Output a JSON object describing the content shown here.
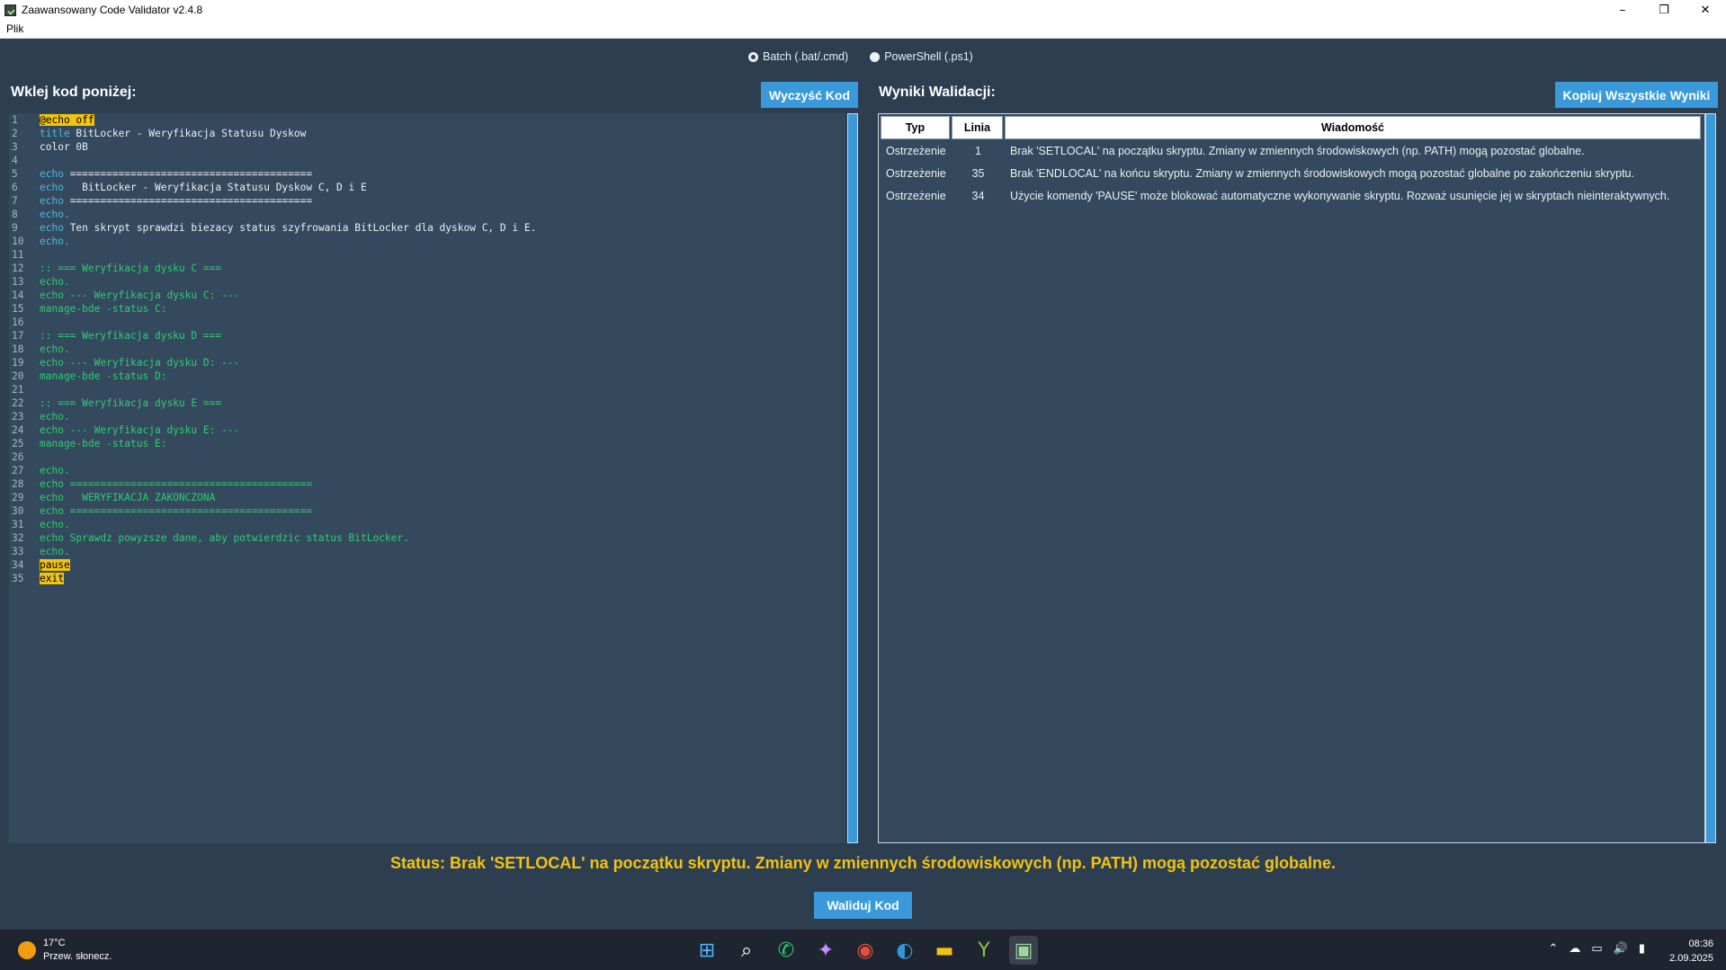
{
  "window": {
    "title": "Zaawansowany Code Validator v2.4.8",
    "minimize": "–",
    "restore": "❐",
    "close": "✕"
  },
  "menu": {
    "items": [
      "Plik"
    ]
  },
  "script_type": {
    "options": [
      "Batch (.bat/.cmd)",
      "PowerShell (.ps1)"
    ],
    "selected": "Batch (.bat/.cmd)"
  },
  "editor": {
    "heading": "Wklej kod poniżej:",
    "clear_button": "Wyczyść Kod",
    "lines": [
      {
        "n": "1",
        "parts": [
          {
            "t": "@echo off",
            "c": "hl"
          }
        ]
      },
      {
        "n": "2",
        "parts": [
          {
            "t": "title",
            "c": "kw"
          },
          {
            "t": " BitLocker - Weryfikacja Statusu Dyskow",
            "c": "pl"
          }
        ]
      },
      {
        "n": "3",
        "parts": [
          {
            "t": "color 0B",
            "c": "pl"
          }
        ]
      },
      {
        "n": "4",
        "parts": []
      },
      {
        "n": "5",
        "parts": [
          {
            "t": "echo",
            "c": "kw"
          },
          {
            "t": " ========================================",
            "c": "pl"
          }
        ]
      },
      {
        "n": "6",
        "parts": [
          {
            "t": "echo",
            "c": "kw"
          },
          {
            "t": "   BitLocker - Weryfikacja Statusu Dyskow C, D i E",
            "c": "pl"
          }
        ]
      },
      {
        "n": "7",
        "parts": [
          {
            "t": "echo",
            "c": "kw"
          },
          {
            "t": " ========================================",
            "c": "pl"
          }
        ]
      },
      {
        "n": "8",
        "parts": [
          {
            "t": "echo.",
            "c": "kw"
          }
        ]
      },
      {
        "n": "9",
        "parts": [
          {
            "t": "echo",
            "c": "kw"
          },
          {
            "t": " Ten skrypt sprawdzi biezacy status szyfrowania BitLocker dla dyskow C, D i E.",
            "c": "pl"
          }
        ]
      },
      {
        "n": "10",
        "parts": [
          {
            "t": "echo.",
            "c": "kw"
          }
        ]
      },
      {
        "n": "11",
        "parts": []
      },
      {
        "n": "12",
        "parts": [
          {
            "t": ":: === Weryfikacja dysku C ===",
            "c": "cm"
          }
        ]
      },
      {
        "n": "13",
        "parts": [
          {
            "t": "echo.",
            "c": "cm"
          }
        ]
      },
      {
        "n": "14",
        "parts": [
          {
            "t": "echo --- Weryfikacja dysku C: ---",
            "c": "cm"
          }
        ]
      },
      {
        "n": "15",
        "parts": [
          {
            "t": "manage-bde -status C:",
            "c": "cm"
          }
        ]
      },
      {
        "n": "16",
        "parts": []
      },
      {
        "n": "17",
        "parts": [
          {
            "t": ":: === Weryfikacja dysku D ===",
            "c": "cm"
          }
        ]
      },
      {
        "n": "18",
        "parts": [
          {
            "t": "echo.",
            "c": "cm"
          }
        ]
      },
      {
        "n": "19",
        "parts": [
          {
            "t": "echo --- Weryfikacja dysku D: ---",
            "c": "cm"
          }
        ]
      },
      {
        "n": "20",
        "parts": [
          {
            "t": "manage-bde -status D:",
            "c": "cm"
          }
        ]
      },
      {
        "n": "21",
        "parts": []
      },
      {
        "n": "22",
        "parts": [
          {
            "t": ":: === Weryfikacja dysku E ===",
            "c": "cm"
          }
        ]
      },
      {
        "n": "23",
        "parts": [
          {
            "t": "echo.",
            "c": "cm"
          }
        ]
      },
      {
        "n": "24",
        "parts": [
          {
            "t": "echo --- Weryfikacja dysku E: ---",
            "c": "cm"
          }
        ]
      },
      {
        "n": "25",
        "parts": [
          {
            "t": "manage-bde -status E:",
            "c": "cm"
          }
        ]
      },
      {
        "n": "26",
        "parts": []
      },
      {
        "n": "27",
        "parts": [
          {
            "t": "echo.",
            "c": "cm"
          }
        ]
      },
      {
        "n": "28",
        "parts": [
          {
            "t": "echo ========================================",
            "c": "cm"
          }
        ]
      },
      {
        "n": "29",
        "parts": [
          {
            "t": "echo   WERYFIKACJA ZAKONCZONA",
            "c": "cm"
          }
        ]
      },
      {
        "n": "30",
        "parts": [
          {
            "t": "echo ========================================",
            "c": "cm"
          }
        ]
      },
      {
        "n": "31",
        "parts": [
          {
            "t": "echo.",
            "c": "cm"
          }
        ]
      },
      {
        "n": "32",
        "parts": [
          {
            "t": "echo Sprawdz powyzsze dane, aby potwierdzic status BitLocker.",
            "c": "cm"
          }
        ]
      },
      {
        "n": "33",
        "parts": [
          {
            "t": "echo.",
            "c": "cm"
          }
        ]
      },
      {
        "n": "34",
        "parts": [
          {
            "t": "pause",
            "c": "hl"
          }
        ]
      },
      {
        "n": "35",
        "parts": [
          {
            "t": "exit",
            "c": "hl"
          }
        ]
      }
    ]
  },
  "results": {
    "heading": "Wyniki Walidacji:",
    "copy_button": "Kopiuj Wszystkie Wyniki",
    "columns": [
      "Typ",
      "Linia",
      "Wiadomość"
    ],
    "rows": [
      [
        "Ostrzeżenie",
        "1",
        "Brak 'SETLOCAL' na początku skryptu. Zmiany w zmiennych środowiskowych (np. PATH) mogą pozostać globalne."
      ],
      [
        "Ostrzeżenie",
        "35",
        "Brak 'ENDLOCAL' na końcu skryptu. Zmiany w zmiennych środowiskowych mogą pozostać globalne po zakończeniu skryptu."
      ],
      [
        "Ostrzeżenie",
        "34",
        "Użycie komendy 'PAUSE' może blokować automatyczne wykonywanie skryptu. Rozważ usunięcie jej w skryptach nieinteraktywnych."
      ]
    ]
  },
  "status": "Status: Brak 'SETLOCAL' na początku skryptu. Zmiany w zmiennych środowiskowych (np. PATH) mogą pozostać globalne.",
  "validate_button": "Waliduj Kod",
  "taskbar": {
    "temperature": "17°C",
    "weather": "Przew. słonecz.",
    "time": "08:36",
    "date": "2.09.2025",
    "apps": [
      "windows-start-icon",
      "search-icon",
      "whatsapp-icon",
      "copilot-icon",
      "chrome-icon",
      "edge-icon",
      "file-explorer-icon",
      "yandex-icon",
      "code-validator-icon"
    ]
  },
  "colors": {
    "background": "#2c3e50",
    "panel": "#34495e",
    "accent": "#3a9ad9",
    "status": "#f1c40f",
    "keyword": "#4fb8e0",
    "comment": "#2ecc71"
  }
}
